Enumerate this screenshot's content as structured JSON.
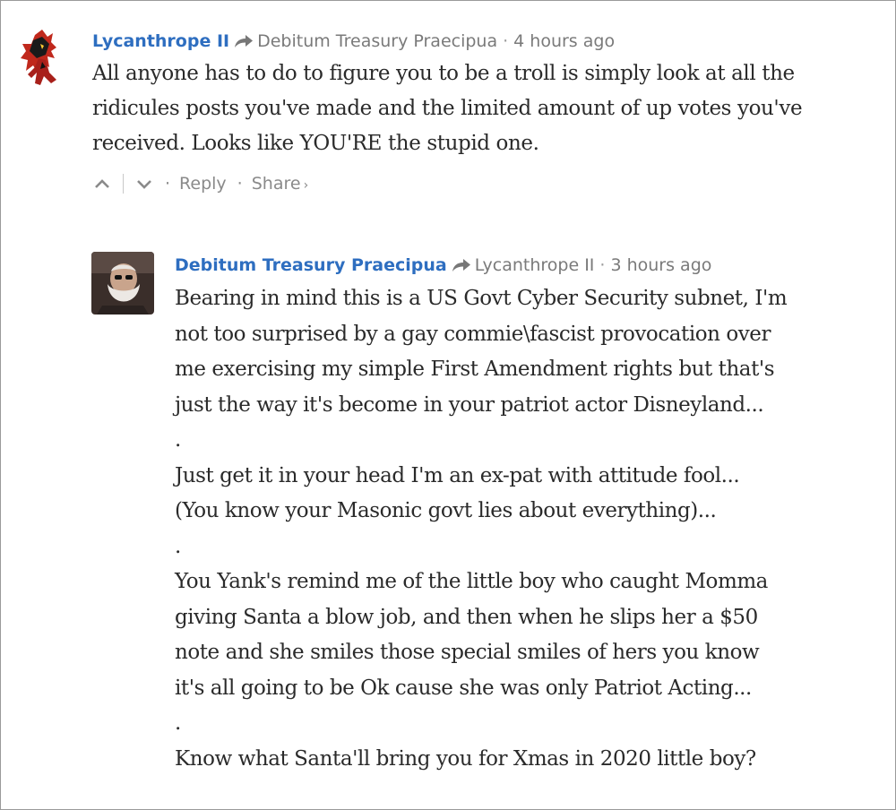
{
  "comments": [
    {
      "author": "Lycanthrope II",
      "reply_to": "Debitum Treasury Praecipua",
      "time": "4 hours ago",
      "lines": [
        "All anyone has to do to figure you to be a troll is simply look at all the",
        "ridicules posts you've made and the limited amount of up votes you've",
        "received. Looks like YOU'RE the stupid one."
      ],
      "actions": {
        "reply": "Reply",
        "share": "Share",
        "share_chevron": "›"
      }
    },
    {
      "author": "Debitum Treasury Praecipua",
      "reply_to": "Lycanthrope II",
      "time": "3 hours ago",
      "lines": [
        "Bearing in mind this is a US Govt Cyber Security subnet, I'm",
        "not too surprised by a gay commie\\fascist provocation over",
        "me exercising my simple First Amendment rights but that's",
        "just the way it's become in your patriot actor Disneyland...",
        ".",
        "Just get it in your head I'm an ex-pat with attitude fool...",
        "(You know your Masonic govt lies about everything)...",
        ".",
        "You Yank's remind me of the little boy who caught Momma",
        "giving Santa a blow job, and then when he slips her a $50",
        "note and she smiles those special smiles of hers you know",
        "it's all going to be Ok cause she was only Patriot Acting...",
        ".",
        "Know what Santa'll bring you for Xmas in 2020 little boy?"
      ]
    }
  ],
  "meta": {
    "separator": "·"
  },
  "icons": {
    "reply_arrow": "reply-arrow-icon",
    "upvote": "upvote-chevron-icon",
    "downvote": "downvote-chevron-icon"
  },
  "colors": {
    "author_link": "#2e6ec0",
    "meta_text": "#7a7a7a",
    "body_text": "#2a2a2a"
  }
}
